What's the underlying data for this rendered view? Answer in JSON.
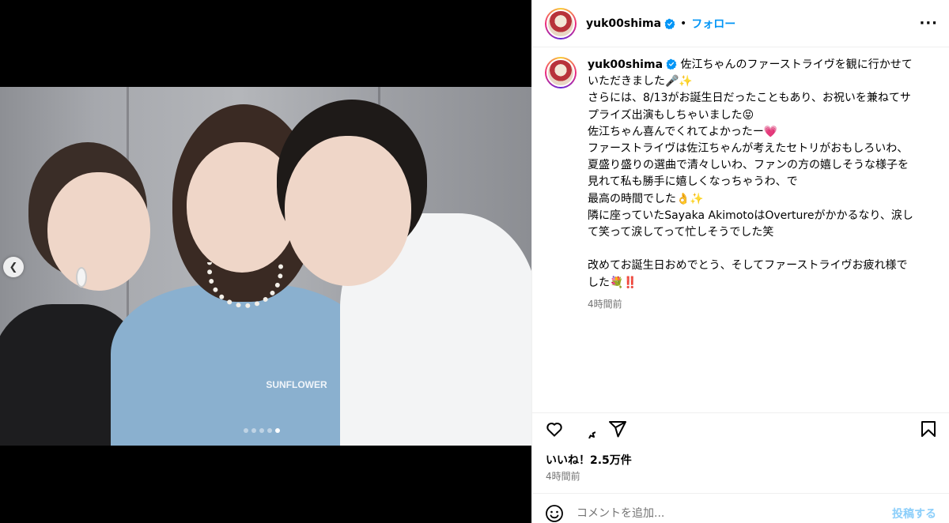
{
  "post": {
    "username": "yuk00shima",
    "follow_label": "フォロー",
    "separator": "•",
    "more_label": "···",
    "caption": "佐江ちゃんのファーストライヴを観に行かせていただきました🎤✨\nさらには、8/13がお誕生日だったこともあり、お祝いを兼ねてサプライズ出演もしちゃいました😝\n佐江ちゃん喜んでくれてよかったー💗\nファーストライヴは佐江ちゃんが考えたセトリがおもしろいわ、夏盛り盛りの選曲で清々しいわ、ファンの方の嬉しそうな様子を見れて私も勝手に嬉しくなっちゃうわ、で\n最高の時間でした👌✨\n隣に座っていたSayaka AkimotoはOvertureがかかるなり、涙して笑って涙してって忙しそうでした笑\n\n改めてお誕生日おめでとう、そしてファーストライヴお疲れ様でした💐‼️",
    "caption_time": "4時間前",
    "likes": "いいね！2.5万件",
    "post_time": "4時間前",
    "carousel": {
      "count": 5,
      "active_index": 5
    }
  },
  "comment_box": {
    "placeholder": "コメントを追加...",
    "post_label": "投稿する"
  },
  "icons": [
    "verified-badge-icon",
    "heart-icon",
    "comment-icon",
    "share-icon",
    "bookmark-icon",
    "emoji-icon",
    "chevron-left-icon"
  ],
  "colors": {
    "accent": "#0095f6",
    "muted": "#737373",
    "verified": "#0095f6"
  }
}
